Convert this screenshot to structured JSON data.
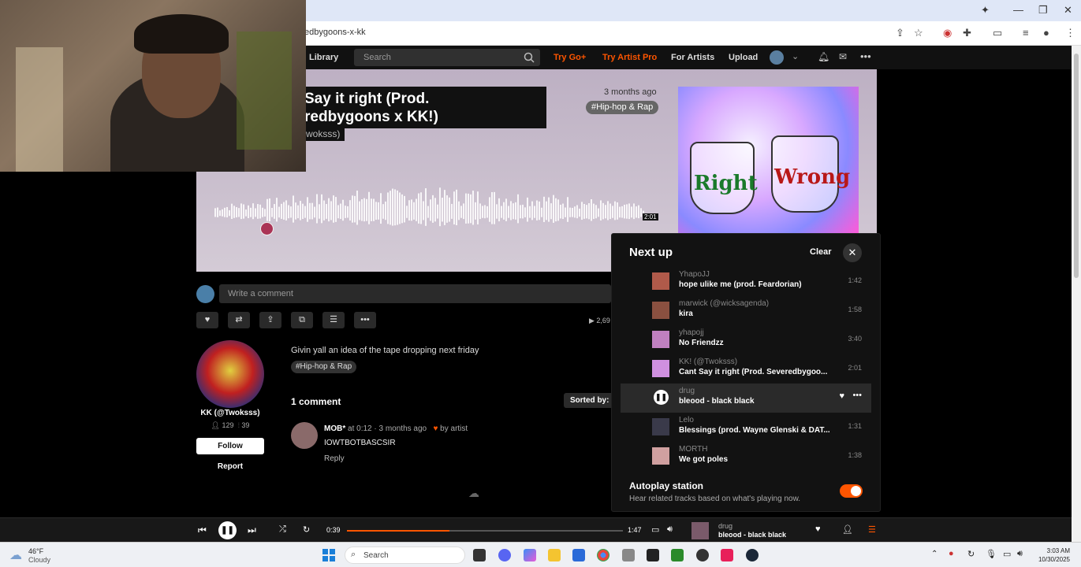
{
  "browser": {
    "url_fragment": "edbygoons-x-kk"
  },
  "nav": {
    "library": "Library",
    "search_placeholder": "Search",
    "try_go": "Try Go+",
    "try_artist_pro": "Try Artist Pro",
    "for_artists": "For Artists",
    "upload": "Upload",
    "accent_color": "#ff5500"
  },
  "hero": {
    "title_line1": "Say it right (Prod.",
    "title_line2": "redbygoons x KK!)",
    "artist": "woksss)",
    "date": "3 months ago",
    "tag": "#Hip-hop & Rap",
    "wave_duration": "2:01"
  },
  "comment_box": {
    "placeholder": "Write a comment"
  },
  "stats": {
    "plays": "▶ 2,69"
  },
  "artist": {
    "name": "KK (@Twoksss)",
    "followers": "129",
    "tracks": "39",
    "follow_label": "Follow",
    "report_label": "Report"
  },
  "track_info": {
    "description": "Givin yall an idea of the tape dropping next friday",
    "tag": "#Hip-hop & Rap",
    "comments_count": "1 comment",
    "sorted_by": "Sorted by:"
  },
  "comment": {
    "user": "MOB*",
    "at": "at",
    "timestamp": "0:12",
    "age": "· 3 months ago",
    "liked_by": "by artist",
    "text": "IOWTBOTBASCSIR",
    "reply": "Reply"
  },
  "next_up": {
    "title": "Next up",
    "clear": "Clear",
    "tracks": [
      {
        "artist": "YhapoJJ",
        "title": "hope ulike me (prod. Feardorian)",
        "duration": "1:42"
      },
      {
        "artist": "marwick (@wicksagenda)",
        "title": "kira",
        "duration": "1:58"
      },
      {
        "artist": "yhapojj",
        "title": "No Friendzz",
        "duration": "3:40"
      },
      {
        "artist": "KK! (@Twoksss)",
        "title": "Cant Say it right (Prod. Severedbygoo...",
        "duration": "2:01"
      },
      {
        "artist": "drug",
        "title": "bleood - black black",
        "duration": ""
      },
      {
        "artist": "Lelo",
        "title": "Blessings (prod. Wayne Glenski & DAT...",
        "duration": "1:31"
      },
      {
        "artist": "MORTH",
        "title": "We got poles",
        "duration": "1:38"
      }
    ],
    "autoplay_title": "Autoplay station",
    "autoplay_sub": "Hear related tracks based on what's playing now.",
    "autoplay_on": true
  },
  "player": {
    "current_time": "0:39",
    "duration": "1:47",
    "progress_fraction": 0.37,
    "artist": "drug",
    "title": "bleood - black black"
  },
  "taskbar": {
    "weather_temp": "46°F",
    "weather_cond": "Cloudy",
    "search": "Search",
    "time": "3:03 AM",
    "date": "10/30/2025"
  }
}
